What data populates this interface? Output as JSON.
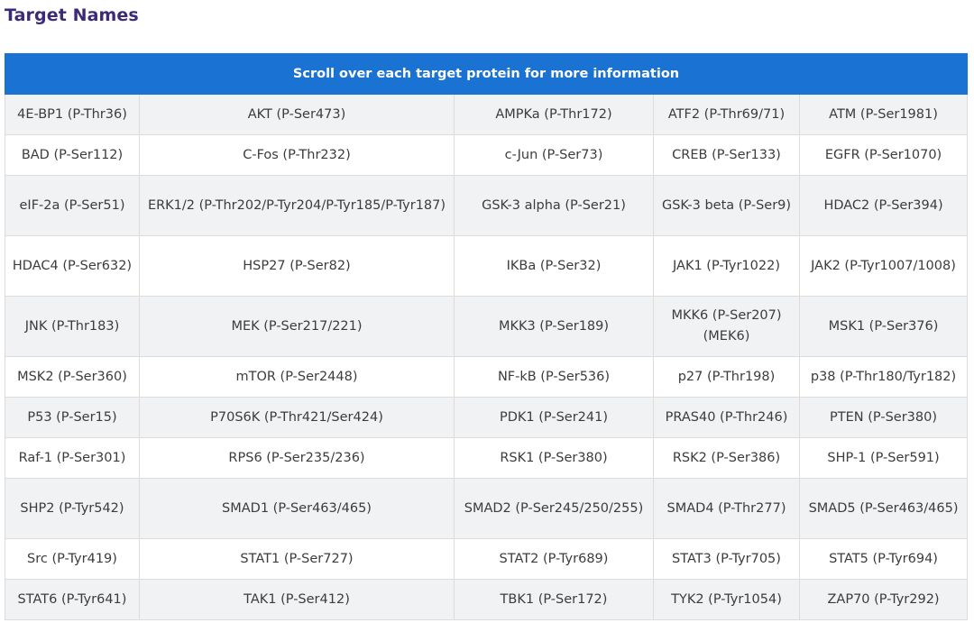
{
  "page": {
    "title": "Target Names"
  },
  "table": {
    "banner": "Scroll over each target protein for more information",
    "rows": [
      [
        "4E-BP1 (P-Thr36)",
        "AKT (P-Ser473)",
        "AMPKa (P-Thr172)",
        "ATF2 (P-Thr69/71)",
        "ATM (P-Ser1981)"
      ],
      [
        "BAD (P-Ser112)",
        "C-Fos (P-Thr232)",
        "c-Jun (P-Ser73)",
        "CREB (P-Ser133)",
        "EGFR (P-Ser1070)"
      ],
      [
        "eIF-2a (P-Ser51)",
        "ERK1/2 (P-Thr202/P-Tyr204/P-Tyr185/P-Tyr187)",
        "GSK-3 alpha (P-Ser21)",
        "GSK-3 beta (P-Ser9)",
        "HDAC2 (P-Ser394)"
      ],
      [
        "HDAC4 (P-Ser632)",
        "HSP27 (P-Ser82)",
        "IKBa (P-Ser32)",
        "JAK1 (P-Tyr1022)",
        "JAK2 (P-Tyr1007/1008)"
      ],
      [
        "JNK (P-Thr183)",
        "MEK (P-Ser217/221)",
        "MKK3 (P-Ser189)",
        "MKK6 (P-Ser207) (MEK6)",
        "MSK1 (P-Ser376)"
      ],
      [
        "MSK2 (P-Ser360)",
        "mTOR (P-Ser2448)",
        "NF-kB (P-Ser536)",
        "p27 (P-Thr198)",
        "p38 (P-Thr180/Tyr182)"
      ],
      [
        "P53 (P-Ser15)",
        "P70S6K (P-Thr421/Ser424)",
        "PDK1 (P-Ser241)",
        "PRAS40 (P-Thr246)",
        "PTEN (P-Ser380)"
      ],
      [
        "Raf-1 (P-Ser301)",
        "RPS6 (P-Ser235/236)",
        "RSK1 (P-Ser380)",
        "RSK2 (P-Ser386)",
        "SHP-1 (P-Ser591)"
      ],
      [
        "SHP2 (P-Tyr542)",
        "SMAD1 (P-Ser463/465)",
        "SMAD2 (P-Ser245/250/255)",
        "SMAD4 (P-Thr277)",
        "SMAD5 (P-Ser463/465)"
      ],
      [
        "Src (P-Tyr419)",
        "STAT1 (P-Ser727)",
        "STAT2 (P-Tyr689)",
        "STAT3 (P-Tyr705)",
        "STAT5 (P-Tyr694)"
      ],
      [
        "STAT6 (P-Tyr641)",
        "TAK1 (P-Ser412)",
        "TBK1 (P-Ser172)",
        "TYK2 (P-Tyr1054)",
        "ZAP70 (P-Tyr292)"
      ]
    ]
  },
  "colors": {
    "title": "#3b2a78",
    "banner_background": "#1a73d2",
    "banner_text": "#ffffff",
    "shaded_row": "#f1f2f4",
    "plain_row": "#ffffff",
    "cell_border": "#dcdcdc"
  }
}
